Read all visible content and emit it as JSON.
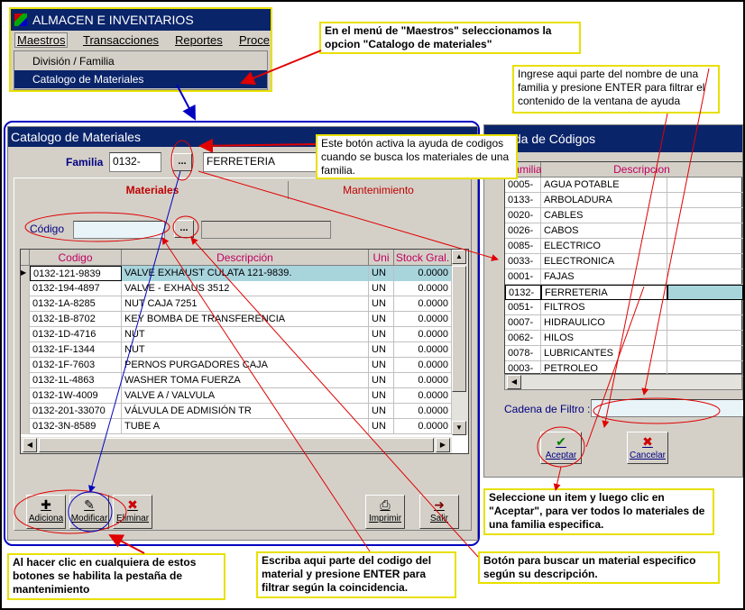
{
  "app": {
    "title": "ALMACEN E INVENTARIOS"
  },
  "menu": [
    "Maestros",
    "Transacciones",
    "Reportes",
    "Proce"
  ],
  "dropdown": [
    "División / Familia",
    "Catalogo de Materiales"
  ],
  "catalog": {
    "title": "Catalogo de Materiales",
    "familia_label": "Familia",
    "familia_code": "0132-",
    "familia_name": "FERRETERIA",
    "browse_label": "...",
    "tabs": [
      "Materiales",
      "Mantenimiento"
    ],
    "codigo_label": "Código",
    "codigo_value": "",
    "columns": [
      "Codigo",
      "Descripción",
      "Uni",
      "Stock Gral."
    ],
    "rows": [
      [
        "0132-121-9839",
        "VALVE EXHAUST CULATA  121-9839.",
        "UN",
        "0.0000"
      ],
      [
        "0132-194-4897",
        "VALVE - EXHAUS  3512",
        "UN",
        "0.0000"
      ],
      [
        "0132-1A-8285",
        "NUT  CAJA 7251",
        "UN",
        "0.0000"
      ],
      [
        "0132-1B-8702",
        "KEY  BOMBA DE TRANSFERENCIA",
        "UN",
        "0.0000"
      ],
      [
        "0132-1D-4716",
        "NUT",
        "UN",
        "0.0000"
      ],
      [
        "0132-1F-1344",
        "NUT",
        "UN",
        "0.0000"
      ],
      [
        "0132-1F-7603",
        "PERNOS PURGADORES  CAJA",
        "UN",
        "0.0000"
      ],
      [
        "0132-1L-4863",
        "WASHER TOMA FUERZA",
        "UN",
        "0.0000"
      ],
      [
        "0132-1W-4009",
        "VALVE  A / VALVULA",
        "UN",
        "0.0000"
      ],
      [
        "0132-201-33070",
        "VÁLVULA DE ADMISIÓN TR",
        "UN",
        "0.0000"
      ],
      [
        "0132-3N-8589",
        "TUBE A",
        "UN",
        "0.0000"
      ]
    ],
    "buttons": [
      "Adiciona",
      "Modificar",
      "Eliminar",
      "Imprimir",
      "Salir"
    ]
  },
  "help": {
    "title": "Ayuda de Códigos",
    "columns": [
      "Familia",
      "Descripcion"
    ],
    "rows": [
      [
        "0005-",
        "AGUA POTABLE"
      ],
      [
        "0133-",
        "ARBOLADURA"
      ],
      [
        "0020-",
        "CABLES"
      ],
      [
        "0026-",
        "CABOS"
      ],
      [
        "0085-",
        "ELECTRICO"
      ],
      [
        "0033-",
        "ELECTRONICA"
      ],
      [
        "0001-",
        "FAJAS"
      ],
      [
        "0132-",
        "FERRETERIA"
      ],
      [
        "0051-",
        "FILTROS"
      ],
      [
        "0007-",
        "HIDRAULICO"
      ],
      [
        "0062-",
        "HILOS"
      ],
      [
        "0078-",
        "LUBRICANTES"
      ],
      [
        "0003-",
        "PETROLEO"
      ]
    ],
    "filter_label": "Cadena de Filtro :",
    "filter_value": "",
    "accept_label": "Aceptar",
    "cancel_label": "Cancelar"
  },
  "notes": {
    "menu_note": "En el menú de \"Maestros\" seleccionamos la opcion \"Catalogo de materiales\"",
    "filter_note": "Ingrese aqui parte del nombre de una familia y presione ENTER para filtrar el contenido de la ventana de ayuda",
    "browse_note": "Este botón activa la ayuda de codigos cuando se busca los materiales de una familia.",
    "accept_note": "Seleccione un item y luego clic en \"Aceptar\", para ver todos lo materiales de una familia especifica.",
    "buttons_note": "Al hacer clic en cualquiera de estos botones se habilita la pestaña de mantenimiento",
    "code_note": "Escriba aqui parte del codigo del material y presione ENTER para filtrar según la coincidencia.",
    "search_note": "Botón para buscar un material especifico según su descripción."
  },
  "colors": {
    "titlebar": "#0a246a",
    "note_border": "#e8e000",
    "header_text": "#c00060",
    "selection": "#a8d4dc"
  }
}
